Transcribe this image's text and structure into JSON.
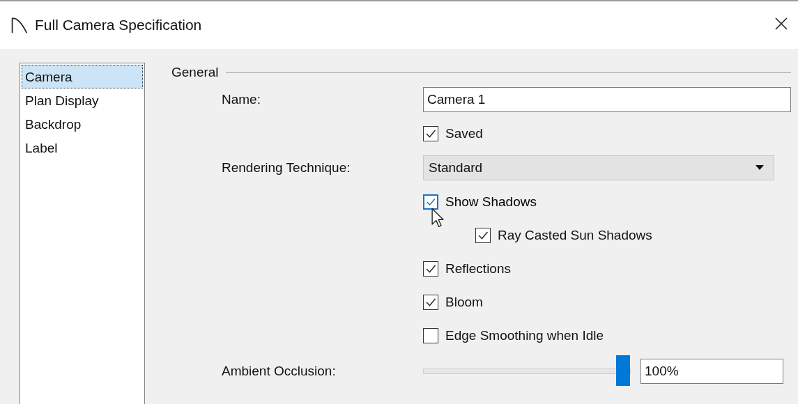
{
  "window": {
    "title": "Full Camera Specification"
  },
  "sidebar": {
    "items": [
      {
        "label": "Camera",
        "selected": true
      },
      {
        "label": "Plan Display",
        "selected": false
      },
      {
        "label": "Backdrop",
        "selected": false
      },
      {
        "label": "Label",
        "selected": false
      }
    ]
  },
  "group": {
    "title": "General"
  },
  "fields": [
    {
      "kind": "text",
      "label": "Name:",
      "value": "Camera 1"
    },
    {
      "kind": "checkbox",
      "label": "Saved",
      "checked": true,
      "focused": false
    },
    {
      "kind": "dropdown",
      "label": "Rendering Technique:",
      "value": "Standard"
    },
    {
      "kind": "checkbox",
      "label": "Show Shadows",
      "checked": true,
      "focused": true,
      "children": [
        {
          "kind": "checkbox",
          "label": "Ray Casted Sun Shadows",
          "checked": true,
          "focused": false
        }
      ]
    },
    {
      "kind": "checkbox",
      "label": "Reflections",
      "checked": true,
      "focused": false
    },
    {
      "kind": "checkbox",
      "label": "Bloom",
      "checked": true,
      "focused": false
    },
    {
      "kind": "checkbox",
      "label": "Edge Smoothing when Idle",
      "checked": false,
      "focused": false
    },
    {
      "kind": "slider",
      "label": "Ambient Occlusion:",
      "level": 1,
      "reading": "100%"
    }
  ]
}
